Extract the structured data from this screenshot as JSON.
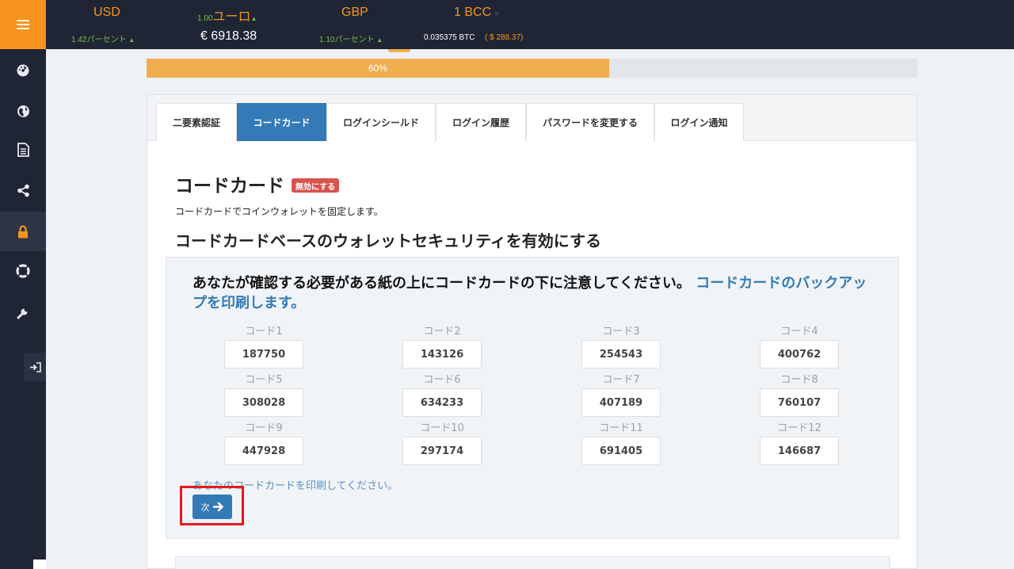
{
  "ticker": {
    "usd": {
      "name": "USD",
      "change": "1.42パーセント"
    },
    "euro": {
      "rate": "1.00",
      "name": "ユーロ",
      "value": "€ 6918.38"
    },
    "gbp": {
      "name": "GBP",
      "change": "1.10パーセント"
    },
    "bcc": {
      "name": "1 BCC",
      "btc": "0.035375 BTC",
      "usd": "( $ 288.37)"
    }
  },
  "sidebar": {
    "items": [
      "dashboard-icon",
      "globe-icon",
      "document-icon",
      "share-icon",
      "lock-icon",
      "lifebuoy-icon",
      "wrench-icon"
    ],
    "active": "lock-icon"
  },
  "progress": {
    "value": 0.6,
    "label": "60%"
  },
  "tabs": [
    "二要素認証",
    "コードカード",
    "ログインシールド",
    "ログイン履歴",
    "パスワードを変更する",
    "ログイン通知"
  ],
  "active_tab": "コードカード",
  "section": {
    "title": "コードカード",
    "disable_badge": "無効にする",
    "description": "コードカードでコインウォレットを固定します。",
    "subtitle": "コードカードベースのウォレットセキュリティを有効にする"
  },
  "card": {
    "instruction": "あなたが確認する必要がある紙の上にコードカードの下に注意してください。",
    "print_link": "コードカードのバックアップを印刷します。",
    "codes": [
      {
        "label": "コード1",
        "value": "187750"
      },
      {
        "label": "コード2",
        "value": "143126"
      },
      {
        "label": "コード3",
        "value": "254543"
      },
      {
        "label": "コード4",
        "value": "400762"
      },
      {
        "label": "コード5",
        "value": "308028"
      },
      {
        "label": "コード6",
        "value": "634233"
      },
      {
        "label": "コード7",
        "value": "407189"
      },
      {
        "label": "コード8",
        "value": "760107"
      },
      {
        "label": "コード9",
        "value": "447928"
      },
      {
        "label": "コード10",
        "value": "297174"
      },
      {
        "label": "コード11",
        "value": "691405"
      },
      {
        "label": "コード12",
        "value": "146687"
      }
    ],
    "print_note": "あなたのコードカードを印刷してください。",
    "next_label": "次"
  },
  "colors": {
    "accent": "#f7941d",
    "primary": "#337ab7",
    "danger": "#d9534f",
    "highlight": "#e5191f",
    "nav_bg": "#1f2535"
  }
}
